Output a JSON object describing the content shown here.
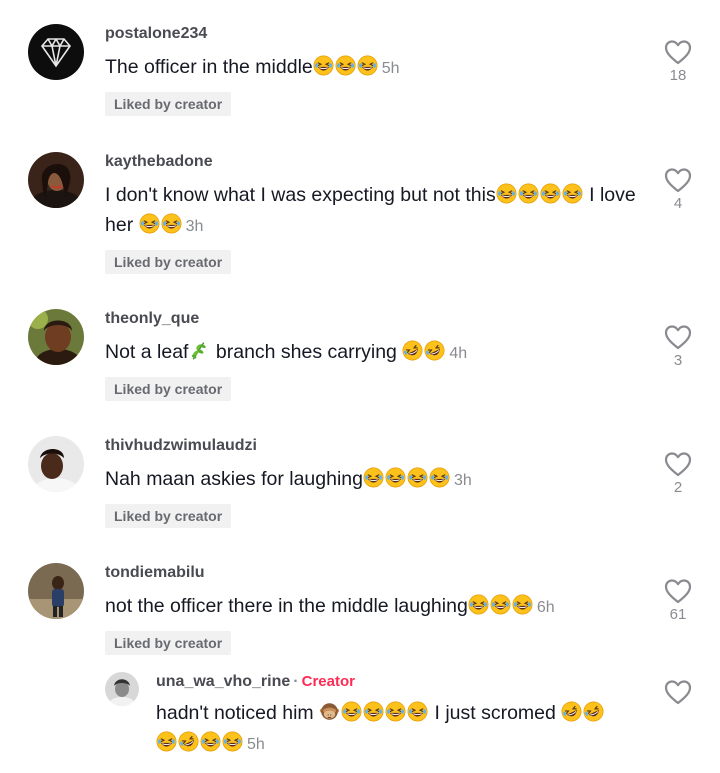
{
  "comments": [
    {
      "username": "postalone234",
      "text": "The officer in the middle",
      "emojis_after": [
        "laughing",
        "laughing",
        "laughing"
      ],
      "time": "5h",
      "liked_by": "Liked by creator",
      "likes": "18"
    },
    {
      "username": "kaythebadone",
      "text": "I don't know what I was expecting but not this",
      "emojis_after": [
        "laughing",
        "laughing",
        "laughing",
        "laughing"
      ],
      "text2": " I love her ",
      "emojis_after2": [
        "laughing",
        "laughing"
      ],
      "time": "3h",
      "liked_by": "Liked by creator",
      "likes": "4"
    },
    {
      "username": "theonly_que",
      "text": "Not a leaf",
      "emoji_mid": "herb",
      "text2": " branch shes carrying ",
      "emojis_after": [
        "rofl",
        "rofl"
      ],
      "time": "4h",
      "liked_by": "Liked by creator",
      "likes": "3"
    },
    {
      "username": "thivhudzwimulaudzi",
      "text": "Nah maan askies for laughing",
      "emojis_after": [
        "laughing",
        "laughing",
        "laughing",
        "laughing"
      ],
      "time": "3h",
      "liked_by": "Liked by creator",
      "likes": "2"
    },
    {
      "username": "tondiemabilu",
      "text": "not the officer there in the middle laughing",
      "emojis_after": [
        "laughing",
        "laughing",
        "laughing"
      ],
      "time": "6h",
      "liked_by": "Liked by creator",
      "likes": "61"
    }
  ],
  "reply": {
    "username": "una_wa_vho_rine",
    "separator": "·",
    "badge": "Creator",
    "text": "hadn't noticed him ",
    "emojis_a": [
      "see-no-evil-monkey",
      "laughing",
      "laughing",
      "laughing",
      "laughing"
    ],
    "text2": " I just scromed ",
    "emojis_b": [
      "rofl",
      "rofl",
      "laughing",
      "rofl",
      "laughing",
      "laughing"
    ],
    "time": "5h"
  },
  "colors": {
    "creator_badge": "#fe2c55",
    "liked_bg": "#f1f1f2",
    "username": "#4a4b52",
    "muted": "#8a8b91"
  }
}
